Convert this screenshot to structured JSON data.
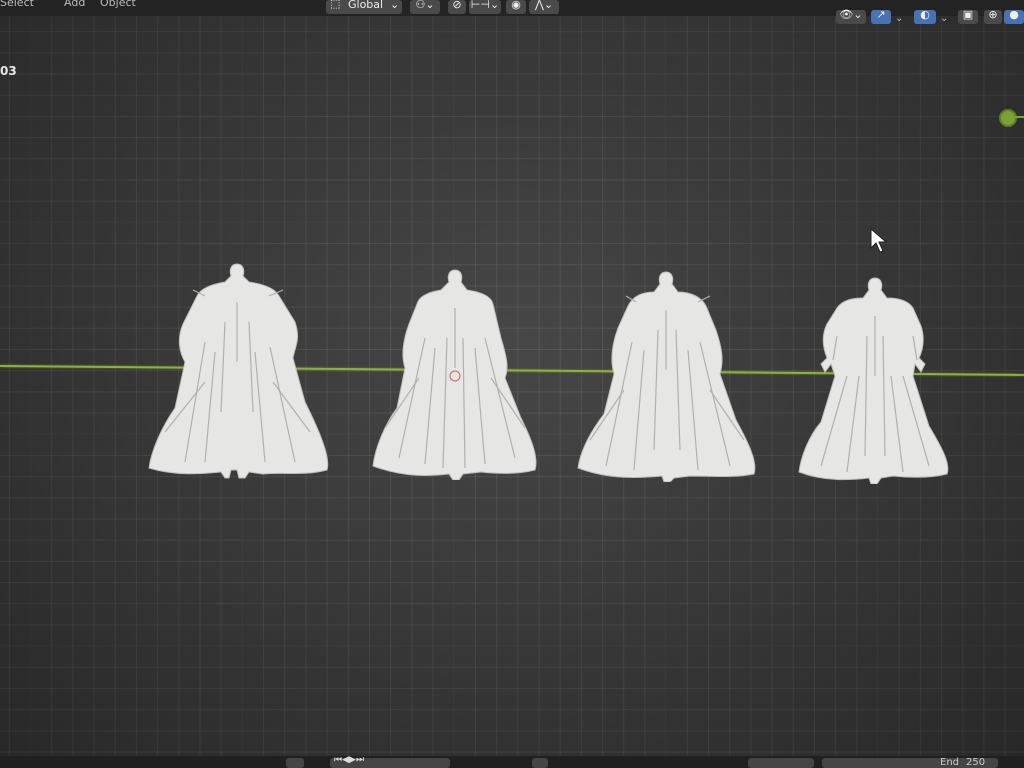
{
  "header": {
    "menu": [
      "Select",
      "Add",
      "Object"
    ],
    "transform_orientation": "Global"
  },
  "viewport": {
    "object_name_partial": "03",
    "models": [
      {
        "name": "dress-model-1"
      },
      {
        "name": "dress-model-2"
      },
      {
        "name": "dress-model-3"
      },
      {
        "name": "dress-model-4"
      }
    ]
  },
  "footer": {
    "end_label": "End",
    "end_frame": "250"
  },
  "colors": {
    "x_axis": "#8ab33a",
    "active_button": "#4772b3",
    "model_fill": "#e6e6e4"
  },
  "icons": [
    "transform-orientation-icon",
    "pivot-icon",
    "snap-icon",
    "snap-increment-icon",
    "proportional-edit-icon",
    "falloff-icon",
    "visibility-icon",
    "gizmo-icon",
    "overlay-icon",
    "xray-icon",
    "wireframe-shading-icon",
    "solid-shading-icon",
    "mouse-cursor-icon"
  ]
}
